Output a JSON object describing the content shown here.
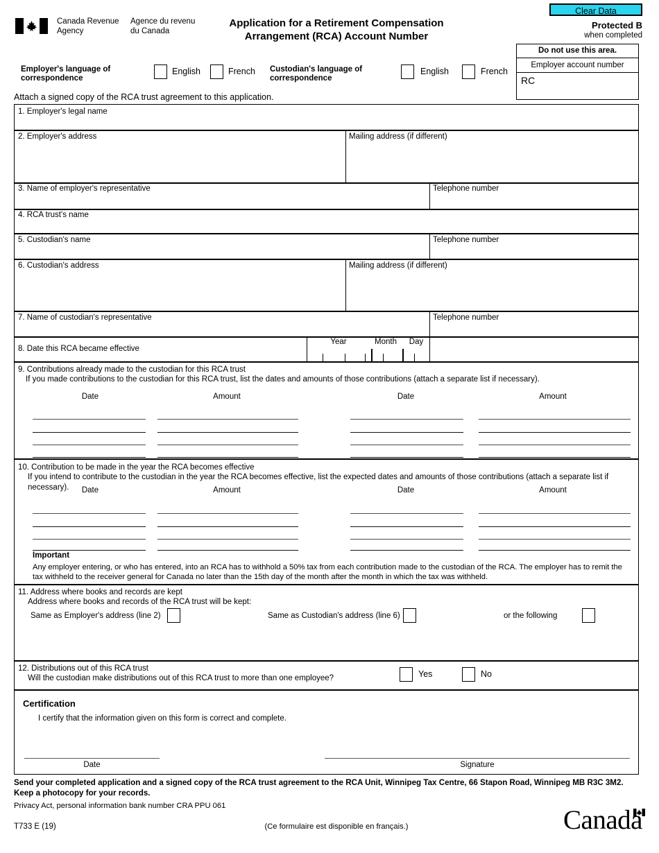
{
  "header": {
    "clear_data_label": "Clear Data",
    "agency_en": "Canada Revenue\nAgency",
    "agency_fr": "Agence du revenu\ndu Canada",
    "title": "Application for a Retirement Compensation\nArrangement (RCA) Account Number",
    "protected_b": "Protected B",
    "when_completed": "when completed",
    "do_not_use": "Do not use this area.",
    "employer_account_number_label": "Employer account number",
    "rc_prefix": "RC",
    "rc_value": "",
    "employer_language_label": "Employer's language of\ncorrespondence",
    "custodian_language_label": "Custodian's language of\ncorrespondence",
    "english": "English",
    "french": "French",
    "attach_note": "Attach a signed copy of the RCA trust agreement to this application."
  },
  "fields": {
    "line1_label": "1. Employer's legal name",
    "line1_value": "",
    "line2_label": "2. Employer's address",
    "line2_value": "",
    "mailing_address_label": "Mailing address (if different)",
    "line2_mailing_value": "",
    "line3_label": "3. Name of employer's representative",
    "line3_value": "",
    "telephone_label": "Telephone number",
    "line3_phone_value": "",
    "line4_label": "4. RCA trust's name",
    "line4_value": "",
    "line5_label": "5. Custodian's name",
    "line5_value": "",
    "line5_phone_value": "",
    "line6_label": "6. Custodian's address",
    "line6_value": "",
    "line6_mailing_value": "",
    "line7_label": "7. Name of custodian's representative",
    "line7_value": "",
    "line7_phone_value": "",
    "line8_label": "8. Date this RCA became effective",
    "date_year": "Year",
    "date_month": "Month",
    "date_day": "Day",
    "line8_value": ""
  },
  "section9": {
    "title": "9. Contributions already made to the custodian for this RCA trust",
    "subtitle": "If you made contributions to the custodian for this RCA trust, list the dates and amounts of those contributions (attach a separate list if necessary).",
    "col_date": "Date",
    "col_amount": "Amount",
    "rows": [
      {
        "date_left": "",
        "amount_left": "",
        "date_right": "",
        "amount_right": ""
      },
      {
        "date_left": "",
        "amount_left": "",
        "date_right": "",
        "amount_right": ""
      },
      {
        "date_left": "",
        "amount_left": "",
        "date_right": "",
        "amount_right": ""
      },
      {
        "date_left": "",
        "amount_left": "",
        "date_right": "",
        "amount_right": ""
      }
    ]
  },
  "section10": {
    "title": "10. Contribution to be made in the year the RCA becomes effective",
    "subtitle": "If you intend to contribute to the custodian in the year the RCA becomes effective, list the expected dates and amounts of those contributions (attach a separate list if necessary).",
    "col_date": "Date",
    "col_amount": "Amount",
    "rows": [
      {
        "date_left": "",
        "amount_left": "",
        "date_right": "",
        "amount_right": ""
      },
      {
        "date_left": "",
        "amount_left": "",
        "date_right": "",
        "amount_right": ""
      },
      {
        "date_left": "",
        "amount_left": "",
        "date_right": "",
        "amount_right": ""
      },
      {
        "date_left": "",
        "amount_left": "",
        "date_right": "",
        "amount_right": ""
      }
    ],
    "important_label": "Important",
    "important_text": "Any employer entering, or who has entered, into an RCA has to withhold a 50% tax from each contribution made to the custodian of the RCA. The employer has to remit the tax withheld to the receiver general for Canada no later than the 15th day of the month after the month in which the tax was withheld."
  },
  "section11": {
    "title": "11. Address where books and records are kept",
    "subtitle": "Address where books and records of the RCA trust will be kept:",
    "option_employer": "Same as Employer's address (line 2)",
    "option_custodian": "Same as Custodian's address (line 6)",
    "option_other": "or the following",
    "other_address_value": ""
  },
  "section12": {
    "title": "12. Distributions out of this RCA trust",
    "question": "Will the custodian make distributions out of this RCA trust to more than one employee?",
    "yes": "Yes",
    "no": "No"
  },
  "certification": {
    "title": "Certification",
    "statement": "I certify that the information given on this form is correct and complete.",
    "date_caption": "Date",
    "signature_caption": "Signature",
    "date_value": "",
    "signature_value": ""
  },
  "footer": {
    "send_note": "Send your completed application and a signed copy of the RCA trust agreement to the RCA Unit, Winnipeg Tax Centre, 66 Stapon Road, Winnipeg MB  R3C 3M2.\nKeep a photocopy for your records.",
    "privacy_note": "Privacy Act, personal information bank number CRA PPU 061",
    "form_code": "T733 E (19)",
    "french_note": "(Ce formulaire est disponible en français.)",
    "canada_wordmark": "Canada"
  },
  "colors": {
    "clear_data_bg": "#2ad4ec",
    "border": "#000000",
    "rule": "#4c4c4c",
    "page_bg": "#ffffff"
  }
}
